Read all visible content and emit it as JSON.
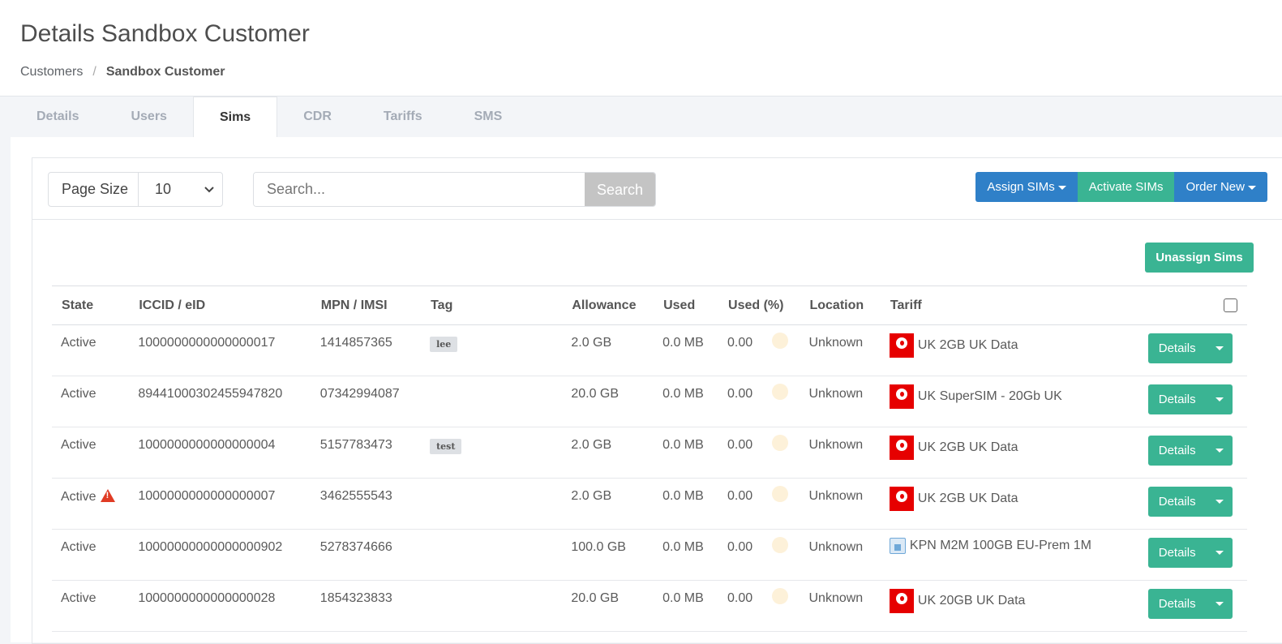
{
  "header": {
    "title": "Details Sandbox Customer",
    "breadcrumb": {
      "parent": "Customers",
      "separator": "/",
      "current": "Sandbox Customer"
    }
  },
  "tabs": [
    {
      "label": "Details"
    },
    {
      "label": "Users"
    },
    {
      "label": "Sims"
    },
    {
      "label": "CDR"
    },
    {
      "label": "Tariffs"
    },
    {
      "label": "SMS"
    }
  ],
  "toolbar": {
    "page_size_label": "Page Size",
    "page_size_value": "10",
    "search_placeholder": "Search...",
    "search_button": "Search",
    "assign_sims": "Assign SIMs",
    "activate_sims": "Activate SIMs",
    "order_new": "Order New",
    "unassign_sims": "Unassign Sims"
  },
  "colors": {
    "accent_green": "#3ab493",
    "accent_blue": "#2f80c8",
    "vodafone_red": "#e60000"
  },
  "table": {
    "columns": [
      "State",
      "ICCID / eID",
      "MPN / IMSI",
      "Tag",
      "Allowance",
      "Used",
      "Used (%)",
      "Location",
      "Tariff"
    ],
    "details_label": "Details",
    "rows": [
      {
        "state": "Active",
        "warning": false,
        "iccid": "1000000000000000017",
        "mpn": "1414857365",
        "tag": "lee",
        "allowance": "2.0 GB",
        "used": "0.0 MB",
        "used_pct": "0.00",
        "location": "Unknown",
        "tariff_icon": "vodafone-icon",
        "tariff": "UK 2GB UK Data"
      },
      {
        "state": "Active",
        "warning": false,
        "iccid": "89441000302455947820",
        "mpn": "07342994087",
        "tag": "",
        "allowance": "20.0 GB",
        "used": "0.0 MB",
        "used_pct": "0.00",
        "location": "Unknown",
        "tariff_icon": "vodafone-icon",
        "tariff": "UK SuperSIM - 20Gb UK"
      },
      {
        "state": "Active",
        "warning": false,
        "iccid": "1000000000000000004",
        "mpn": "5157783473",
        "tag": "test",
        "allowance": "2.0 GB",
        "used": "0.0 MB",
        "used_pct": "0.00",
        "location": "Unknown",
        "tariff_icon": "vodafone-icon",
        "tariff": "UK 2GB UK Data"
      },
      {
        "state": "Active",
        "warning": true,
        "iccid": "1000000000000000007",
        "mpn": "3462555543",
        "tag": "",
        "allowance": "2.0 GB",
        "used": "0.0 MB",
        "used_pct": "0.00",
        "location": "Unknown",
        "tariff_icon": "vodafone-icon",
        "tariff": "UK 2GB UK Data"
      },
      {
        "state": "Active",
        "warning": false,
        "iccid": "10000000000000000902",
        "mpn": "5278374666",
        "tag": "",
        "allowance": "100.0 GB",
        "used": "0.0 MB",
        "used_pct": "0.00",
        "location": "Unknown",
        "tariff_icon": "kpn-icon",
        "tariff": "KPN M2M 100GB EU-Prem 1M"
      },
      {
        "state": "Active",
        "warning": false,
        "iccid": "1000000000000000028",
        "mpn": "1854323833",
        "tag": "",
        "allowance": "20.0 GB",
        "used": "0.0 MB",
        "used_pct": "0.00",
        "location": "Unknown",
        "tariff_icon": "vodafone-icon",
        "tariff": "UK 20GB UK Data"
      }
    ]
  }
}
